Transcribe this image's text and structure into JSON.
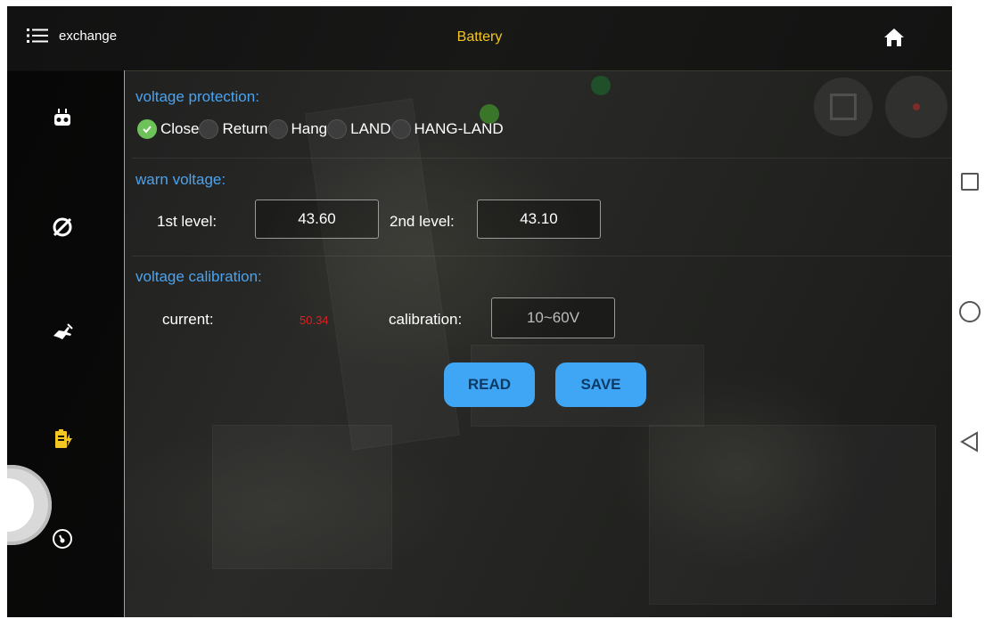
{
  "header": {
    "menu_label": "exchange",
    "title": "Battery"
  },
  "protection": {
    "title": "voltage protection:",
    "options": [
      "Close",
      "Return",
      "Hang",
      "LAND",
      "HANG-LAND"
    ],
    "selected": "Close"
  },
  "warn": {
    "title": "warn voltage:",
    "first_label": "1st level:",
    "first_value": "43.60",
    "second_label": "2nd level:",
    "second_value": "43.10"
  },
  "calibration": {
    "title": "voltage calibration:",
    "current_label": "current:",
    "current_value": "50.34",
    "calibration_label": "calibration:",
    "calibration_placeholder": "10~60V"
  },
  "buttons": {
    "read": "READ",
    "save": "SAVE"
  },
  "colors": {
    "accent_title": "#f3c624",
    "section": "#4aa3f0",
    "button": "#3ea6f4",
    "current_value": "#e01f1f",
    "selected": "#6ec25a"
  }
}
